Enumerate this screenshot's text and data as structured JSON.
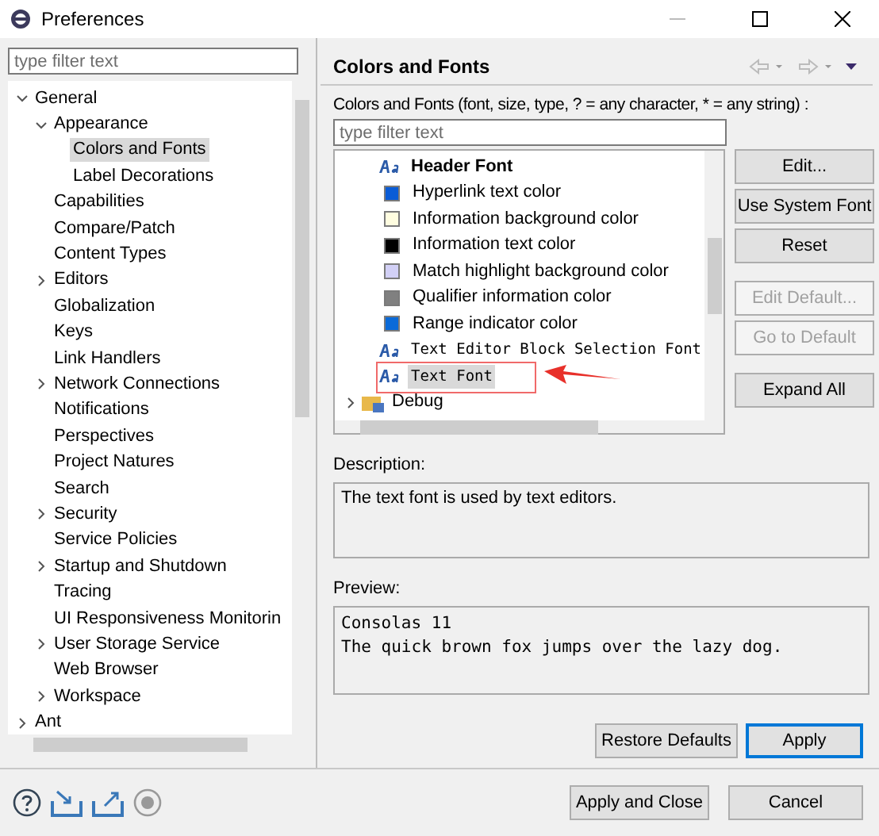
{
  "window": {
    "title": "Preferences"
  },
  "sidebar": {
    "filter": {
      "placeholder": "type filter text"
    },
    "items": [
      {
        "kind": "node",
        "label": "General",
        "expanded": true,
        "selected": false,
        "children": [
          {
            "kind": "node",
            "label": "Appearance",
            "expanded": true,
            "selected": false,
            "children": [
              {
                "kind": "leaf",
                "label": "Colors and Fonts",
                "selected": true
              },
              {
                "kind": "leaf",
                "label": "Label Decorations",
                "selected": false
              }
            ]
          },
          {
            "kind": "leaf",
            "label": "Capabilities",
            "selected": false
          },
          {
            "kind": "leaf",
            "label": "Compare/Patch",
            "selected": false
          },
          {
            "kind": "leaf",
            "label": "Content Types",
            "selected": false
          },
          {
            "kind": "node",
            "label": "Editors",
            "expanded": false,
            "selected": false
          },
          {
            "kind": "leaf",
            "label": "Globalization",
            "selected": false
          },
          {
            "kind": "leaf",
            "label": "Keys",
            "selected": false
          },
          {
            "kind": "leaf",
            "label": "Link Handlers",
            "selected": false
          },
          {
            "kind": "node",
            "label": "Network Connections",
            "expanded": false,
            "selected": false
          },
          {
            "kind": "leaf",
            "label": "Notifications",
            "selected": false
          },
          {
            "kind": "leaf",
            "label": "Perspectives",
            "selected": false
          },
          {
            "kind": "leaf",
            "label": "Project Natures",
            "selected": false
          },
          {
            "kind": "leaf",
            "label": "Search",
            "selected": false
          },
          {
            "kind": "node",
            "label": "Security",
            "expanded": false,
            "selected": false
          },
          {
            "kind": "leaf",
            "label": "Service Policies",
            "selected": false
          },
          {
            "kind": "node",
            "label": "Startup and Shutdown",
            "expanded": false,
            "selected": false
          },
          {
            "kind": "leaf",
            "label": "Tracing",
            "selected": false
          },
          {
            "kind": "leaf",
            "label": "UI Responsiveness Monitorin",
            "selected": false
          },
          {
            "kind": "node",
            "label": "User Storage Service",
            "expanded": false,
            "selected": false
          },
          {
            "kind": "leaf",
            "label": "Web Browser",
            "selected": false
          },
          {
            "kind": "node",
            "label": "Workspace",
            "expanded": false,
            "selected": false
          }
        ]
      },
      {
        "kind": "node",
        "label": "Ant",
        "expanded": false,
        "selected": false
      }
    ]
  },
  "page": {
    "title": "Colors and Fonts",
    "filter_label": "Colors and Fonts (font, size, type, ? = any character, * = any string) :",
    "filter": {
      "placeholder": "type filter text"
    },
    "items": [
      {
        "kind": "heading",
        "label": "Header Font",
        "selected": false
      },
      {
        "kind": "color",
        "color": "#0a5cd6",
        "label": "Hyperlink text color",
        "selected": false
      },
      {
        "kind": "color",
        "color": "#fffde0",
        "label": "Information background color",
        "selected": false
      },
      {
        "kind": "color",
        "color": "#000000",
        "label": "Information text color",
        "selected": false
      },
      {
        "kind": "color",
        "color": "#d2d0f6",
        "label": "Match highlight background color",
        "selected": false
      },
      {
        "kind": "color",
        "color": "#808080",
        "label": "Qualifier information color",
        "selected": false
      },
      {
        "kind": "color",
        "color": "#0a6ad8",
        "label": "Range indicator color",
        "selected": false
      },
      {
        "kind": "font",
        "label": "Text Editor Block Selection Font",
        "selected": false
      },
      {
        "kind": "font",
        "label": "Text Font",
        "selected": true
      },
      {
        "kind": "category",
        "label": "Debug",
        "selected": false
      }
    ],
    "side_buttons": [
      {
        "label": "Edit...",
        "disabled": false
      },
      {
        "label": "Use System Font",
        "disabled": false
      },
      {
        "label": "Reset",
        "disabled": false
      },
      {
        "label": "Edit Default...",
        "disabled": true
      },
      {
        "label": "Go to Default",
        "disabled": true
      },
      {
        "label": "Expand All",
        "disabled": false
      }
    ],
    "description_label": "Description:",
    "description": "The text font is used by text editors.",
    "preview_label": "Preview:",
    "preview": [
      "Consolas 11",
      "The quick brown fox jumps over the lazy dog."
    ],
    "buttons": [
      {
        "label": "Restore Defaults",
        "default": false
      },
      {
        "label": "Apply",
        "default": true
      }
    ]
  },
  "footer": {
    "buttons": [
      {
        "label": "Apply and Close",
        "default": false
      },
      {
        "label": "Cancel",
        "default": false
      }
    ]
  }
}
